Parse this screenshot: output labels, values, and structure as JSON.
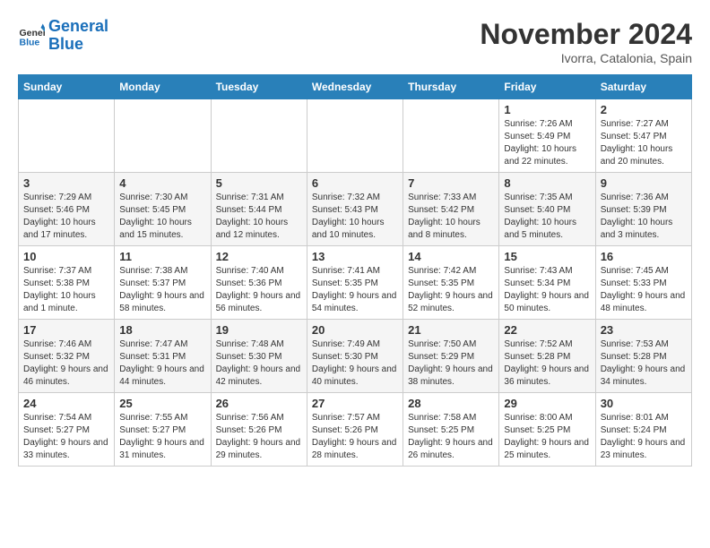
{
  "logo": {
    "line1": "General",
    "line2": "Blue"
  },
  "title": "November 2024",
  "location": "Ivorra, Catalonia, Spain",
  "days_header": [
    "Sunday",
    "Monday",
    "Tuesday",
    "Wednesday",
    "Thursday",
    "Friday",
    "Saturday"
  ],
  "weeks": [
    [
      {
        "day": "",
        "info": ""
      },
      {
        "day": "",
        "info": ""
      },
      {
        "day": "",
        "info": ""
      },
      {
        "day": "",
        "info": ""
      },
      {
        "day": "",
        "info": ""
      },
      {
        "day": "1",
        "info": "Sunrise: 7:26 AM\nSunset: 5:49 PM\nDaylight: 10 hours\nand 22 minutes."
      },
      {
        "day": "2",
        "info": "Sunrise: 7:27 AM\nSunset: 5:47 PM\nDaylight: 10 hours\nand 20 minutes."
      }
    ],
    [
      {
        "day": "3",
        "info": "Sunrise: 7:29 AM\nSunset: 5:46 PM\nDaylight: 10 hours\nand 17 minutes."
      },
      {
        "day": "4",
        "info": "Sunrise: 7:30 AM\nSunset: 5:45 PM\nDaylight: 10 hours\nand 15 minutes."
      },
      {
        "day": "5",
        "info": "Sunrise: 7:31 AM\nSunset: 5:44 PM\nDaylight: 10 hours\nand 12 minutes."
      },
      {
        "day": "6",
        "info": "Sunrise: 7:32 AM\nSunset: 5:43 PM\nDaylight: 10 hours\nand 10 minutes."
      },
      {
        "day": "7",
        "info": "Sunrise: 7:33 AM\nSunset: 5:42 PM\nDaylight: 10 hours\nand 8 minutes."
      },
      {
        "day": "8",
        "info": "Sunrise: 7:35 AM\nSunset: 5:40 PM\nDaylight: 10 hours\nand 5 minutes."
      },
      {
        "day": "9",
        "info": "Sunrise: 7:36 AM\nSunset: 5:39 PM\nDaylight: 10 hours\nand 3 minutes."
      }
    ],
    [
      {
        "day": "10",
        "info": "Sunrise: 7:37 AM\nSunset: 5:38 PM\nDaylight: 10 hours\nand 1 minute."
      },
      {
        "day": "11",
        "info": "Sunrise: 7:38 AM\nSunset: 5:37 PM\nDaylight: 9 hours\nand 58 minutes."
      },
      {
        "day": "12",
        "info": "Sunrise: 7:40 AM\nSunset: 5:36 PM\nDaylight: 9 hours\nand 56 minutes."
      },
      {
        "day": "13",
        "info": "Sunrise: 7:41 AM\nSunset: 5:35 PM\nDaylight: 9 hours\nand 54 minutes."
      },
      {
        "day": "14",
        "info": "Sunrise: 7:42 AM\nSunset: 5:35 PM\nDaylight: 9 hours\nand 52 minutes."
      },
      {
        "day": "15",
        "info": "Sunrise: 7:43 AM\nSunset: 5:34 PM\nDaylight: 9 hours\nand 50 minutes."
      },
      {
        "day": "16",
        "info": "Sunrise: 7:45 AM\nSunset: 5:33 PM\nDaylight: 9 hours\nand 48 minutes."
      }
    ],
    [
      {
        "day": "17",
        "info": "Sunrise: 7:46 AM\nSunset: 5:32 PM\nDaylight: 9 hours\nand 46 minutes."
      },
      {
        "day": "18",
        "info": "Sunrise: 7:47 AM\nSunset: 5:31 PM\nDaylight: 9 hours\nand 44 minutes."
      },
      {
        "day": "19",
        "info": "Sunrise: 7:48 AM\nSunset: 5:30 PM\nDaylight: 9 hours\nand 42 minutes."
      },
      {
        "day": "20",
        "info": "Sunrise: 7:49 AM\nSunset: 5:30 PM\nDaylight: 9 hours\nand 40 minutes."
      },
      {
        "day": "21",
        "info": "Sunrise: 7:50 AM\nSunset: 5:29 PM\nDaylight: 9 hours\nand 38 minutes."
      },
      {
        "day": "22",
        "info": "Sunrise: 7:52 AM\nSunset: 5:28 PM\nDaylight: 9 hours\nand 36 minutes."
      },
      {
        "day": "23",
        "info": "Sunrise: 7:53 AM\nSunset: 5:28 PM\nDaylight: 9 hours\nand 34 minutes."
      }
    ],
    [
      {
        "day": "24",
        "info": "Sunrise: 7:54 AM\nSunset: 5:27 PM\nDaylight: 9 hours\nand 33 minutes."
      },
      {
        "day": "25",
        "info": "Sunrise: 7:55 AM\nSunset: 5:27 PM\nDaylight: 9 hours\nand 31 minutes."
      },
      {
        "day": "26",
        "info": "Sunrise: 7:56 AM\nSunset: 5:26 PM\nDaylight: 9 hours\nand 29 minutes."
      },
      {
        "day": "27",
        "info": "Sunrise: 7:57 AM\nSunset: 5:26 PM\nDaylight: 9 hours\nand 28 minutes."
      },
      {
        "day": "28",
        "info": "Sunrise: 7:58 AM\nSunset: 5:25 PM\nDaylight: 9 hours\nand 26 minutes."
      },
      {
        "day": "29",
        "info": "Sunrise: 8:00 AM\nSunset: 5:25 PM\nDaylight: 9 hours\nand 25 minutes."
      },
      {
        "day": "30",
        "info": "Sunrise: 8:01 AM\nSunset: 5:24 PM\nDaylight: 9 hours\nand 23 minutes."
      }
    ]
  ]
}
